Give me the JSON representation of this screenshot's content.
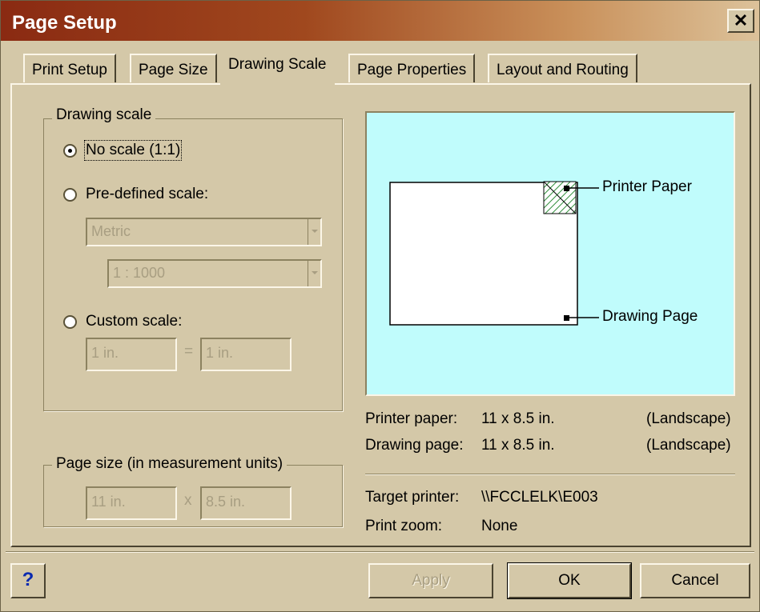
{
  "window": {
    "title": "Page Setup",
    "close_icon": "close-icon"
  },
  "tabs": [
    {
      "label": "Print Setup",
      "active": false
    },
    {
      "label": "Page Size",
      "active": false
    },
    {
      "label": "Drawing Scale",
      "active": true
    },
    {
      "label": "Page Properties",
      "active": false
    },
    {
      "label": "Layout and Routing",
      "active": false
    }
  ],
  "drawing_scale": {
    "legend": "Drawing scale",
    "options": [
      {
        "label": "No scale (1:1)",
        "selected": true
      },
      {
        "label": "Pre-defined scale:",
        "selected": false
      },
      {
        "label": "Custom scale:",
        "selected": false
      }
    ],
    "predefined_units": "Metric",
    "predefined_ratio": "1 : 1000",
    "custom_left": "1 in.",
    "custom_equals": "=",
    "custom_right": "1 in."
  },
  "page_size": {
    "legend": "Page size (in measurement units)",
    "width": "11 in.",
    "times": "x",
    "height": "8.5 in."
  },
  "preview": {
    "background": "#c0fcfc",
    "printer_paper_label": "Printer Paper",
    "drawing_page_label": "Drawing Page"
  },
  "info": {
    "printer_paper_label": "Printer paper:",
    "printer_paper_value": "11 x 8.5 in.",
    "printer_paper_orient": "(Landscape)",
    "drawing_page_label": "Drawing page:",
    "drawing_page_value": "11 x 8.5 in.",
    "drawing_page_orient": "(Landscape)",
    "target_printer_label": "Target printer:",
    "target_printer_value": "\\\\FCCLELK\\E003",
    "print_zoom_label": "Print zoom:",
    "print_zoom_value": "None"
  },
  "buttons": {
    "help": "?",
    "apply": "Apply",
    "ok": "OK",
    "cancel": "Cancel"
  }
}
